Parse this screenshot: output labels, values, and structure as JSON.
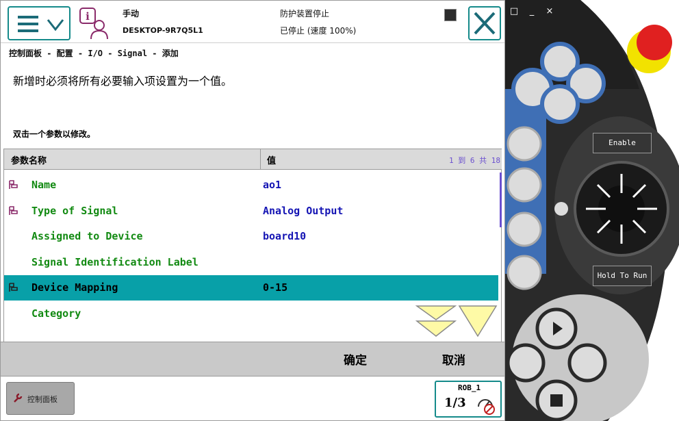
{
  "statusbar": {
    "mode": "手动",
    "host": "DESKTOP-9R7Q5L1",
    "guard": "防护装置停止",
    "state": "已停止 (速度 100%)"
  },
  "breadcrumb": "控制面板 - 配置 - I/O - Signal - 添加",
  "instruction": "新增时必须将所有必要输入项设置为一个值。",
  "hint": "双击一个参数以修改。",
  "table": {
    "headers": {
      "name": "参数名称",
      "value": "值"
    },
    "range_text": "1 到 6 共 18",
    "rows": [
      {
        "name": "Name",
        "value": "ao1",
        "required": true,
        "selected": false
      },
      {
        "name": "Type of Signal",
        "value": "Analog Output",
        "required": true,
        "selected": false
      },
      {
        "name": "Assigned to Device",
        "value": "board10",
        "required": false,
        "selected": false
      },
      {
        "name": "Signal Identification Label",
        "value": "",
        "required": false,
        "selected": false
      },
      {
        "name": "Device Mapping",
        "value": "0-15",
        "required": true,
        "selected": true
      },
      {
        "name": "Category",
        "value": "",
        "required": false,
        "selected": false
      }
    ]
  },
  "actions": {
    "ok": "确定",
    "cancel": "取消"
  },
  "taskbar": {
    "control_panel": "控制面板",
    "robot": "ROB_1",
    "fraction": "1/3"
  },
  "pendant": {
    "enable": "Enable",
    "hold_to_run": "Hold To Run",
    "window_controls": [
      "□",
      "_",
      "×"
    ]
  },
  "colors": {
    "accent": "#148a8a",
    "selected_row": "#08a0a8",
    "param_name": "#128a12",
    "param_value": "#1515b4",
    "pendant_blue": "#3f6fb5",
    "emergency_red": "#e02020",
    "emergency_yellow": "#f2e200"
  },
  "icons": {
    "menu": "menu-icon",
    "person": "person-info-icon",
    "close": "close-icon",
    "required": "required-param-icon",
    "scroll_down": "scroll-down-icon"
  }
}
